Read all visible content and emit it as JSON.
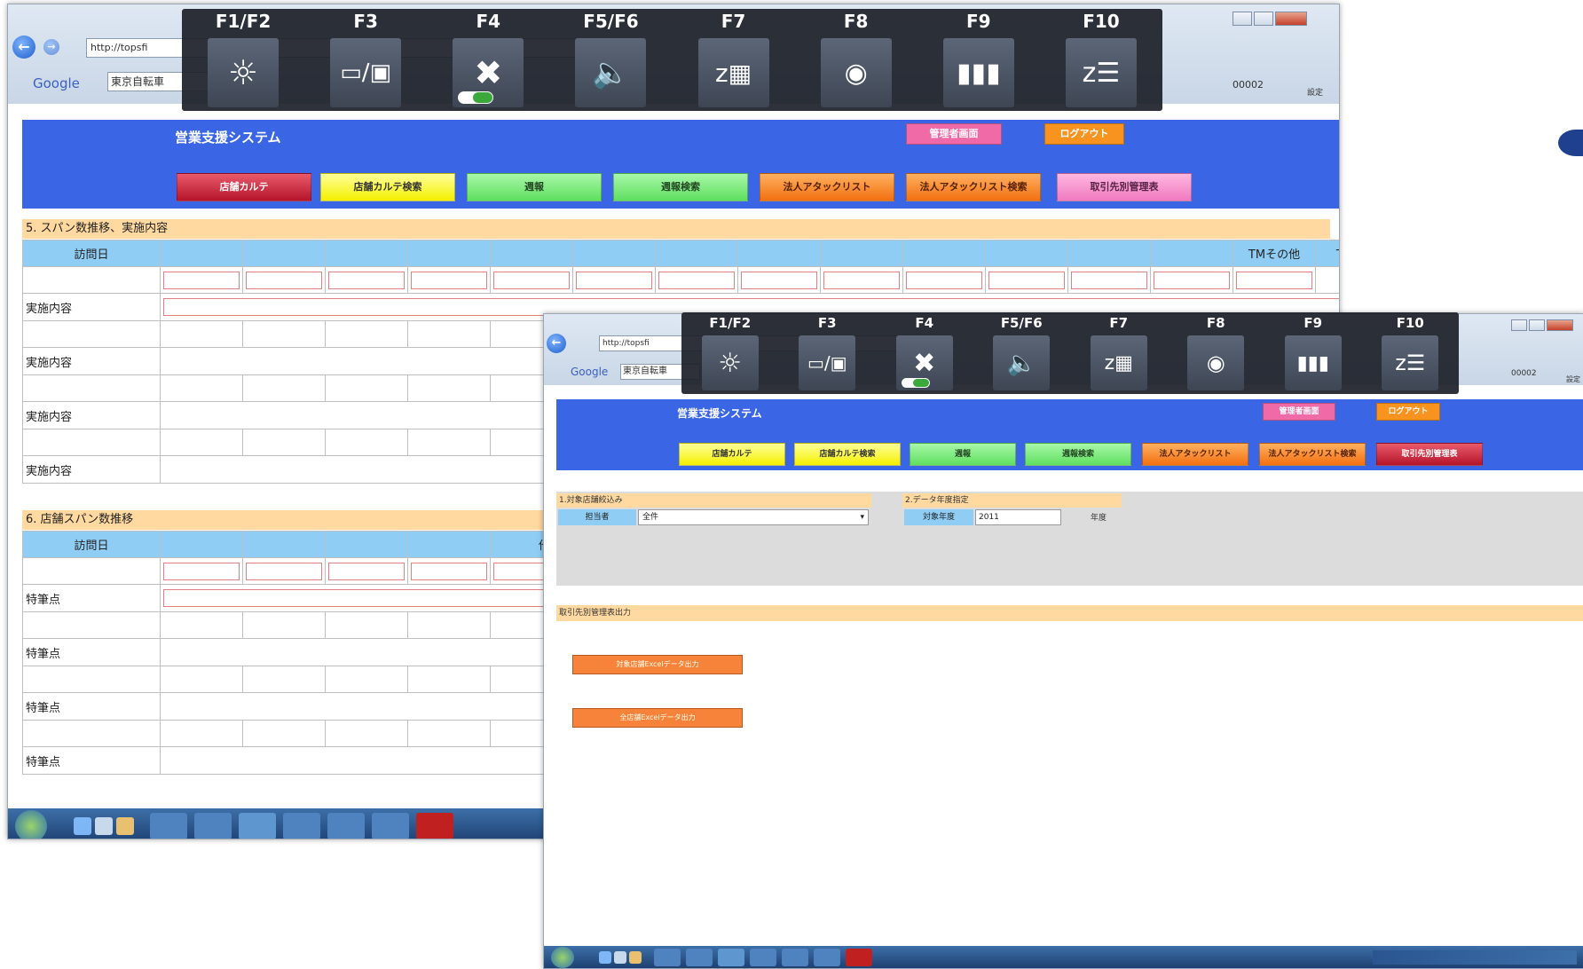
{
  "browser": {
    "address_text": "http://topsfi",
    "google_label": "Google",
    "toolbar_search_text": "東京自転車",
    "account_label": "00002",
    "settings_label": "設定",
    "address_text_small": "http://topsfi",
    "google_label_small": "Google",
    "toolbar_search_text_small": "東京自転車",
    "account_label_small": "00002",
    "settings_label_small": "設定"
  },
  "fkeys": [
    "F1/F2",
    "F3",
    "F4",
    "F5/F6",
    "F7",
    "F8",
    "F9",
    "F10"
  ],
  "fkey_icons": [
    "brightness-icon",
    "display-switch-icon",
    "wireless-off-icon",
    "volume-icon",
    "sleep-icon",
    "projector-icon",
    "battery-icon",
    "hibernate-icon"
  ],
  "left": {
    "app_title": "営業支援システム",
    "header_buttons": [
      "管理者画面",
      "ログアウト"
    ],
    "nav": [
      "店舗カルテ",
      "店舗カルテ検索",
      "週報",
      "週報検索",
      "法人アタックリスト",
      "法人アタックリスト検索",
      "取引先別管理表"
    ],
    "section5_title": "5. スパン数推移、実施内容",
    "section5_header": [
      "訪問日",
      "TMその他",
      "TM合計"
    ],
    "section5_rowlabel": "実施内容",
    "section6_title": "6. 店舗スパン数推移",
    "section6_header": [
      "訪問日",
      "他社その他"
    ],
    "section6_rowlabel": "特筆点"
  },
  "right": {
    "app_title": "営業支援システム",
    "header_buttons": [
      "管理者画面",
      "ログアウト"
    ],
    "nav": [
      "店舗カルテ",
      "店舗カルテ検索",
      "週報",
      "週報検索",
      "法人アタックリスト",
      "法人アタックリスト検索",
      "取引先別管理表"
    ],
    "filter1_title": "1.対象店舗絞込み",
    "filter1_label": "担当者",
    "filter1_value": "全件",
    "filter2_title": "2.データ年度指定",
    "filter2_label": "対象年度",
    "filter2_value": "2011",
    "filter2_unit": "年度",
    "output_title": "取引先別管理表出力",
    "output_buttons": [
      "対象店舗Excelデータ出力",
      "全店舗Excelデータ出力"
    ]
  },
  "colors": {
    "header_blue": "#3a66e6",
    "section_orange": "#ffd9a0",
    "table_header_blue": "#8fcdf5"
  }
}
